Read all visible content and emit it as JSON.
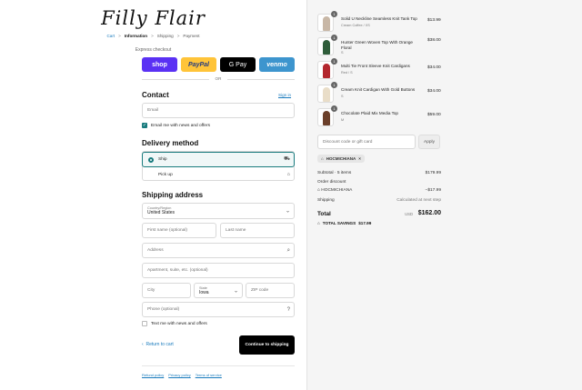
{
  "brand": {
    "logo_text": "Filly Flair"
  },
  "breadcrumb": {
    "items": [
      "Cart",
      "Information",
      "Shipping",
      "Payment"
    ],
    "separator": ">"
  },
  "express": {
    "label": "Express checkout",
    "buttons": [
      "shop",
      "PayPal",
      "G Pay",
      "venmo"
    ],
    "or": "OR"
  },
  "contact": {
    "title": "Contact",
    "sign_in": "Sign in",
    "email_placeholder": "Email",
    "email_news": "Email me with news and offers"
  },
  "delivery": {
    "title": "Delivery method",
    "options": [
      "Ship",
      "Pick up"
    ]
  },
  "shipping": {
    "title": "Shipping address",
    "country_label": "Country/Region",
    "country_value": "United States",
    "first_name": "First name (optional)",
    "last_name": "Last name",
    "address": "Address",
    "apartment": "Apartment, suite, etc. (optional)",
    "city": "City",
    "state_label": "State",
    "state_value": "Iowa",
    "zip": "ZIP code",
    "phone": "Phone (optional)",
    "text_news": "Text me with news and offers"
  },
  "actions": {
    "back": "Return to cart",
    "continue": "Continue to shipping"
  },
  "policies": [
    "Refund policy",
    "Privacy policy",
    "Terms of service"
  ],
  "cart": {
    "items": [
      {
        "qty": "1",
        "name": "Solid U Neckline Seamless Knit Tank Top",
        "variant": "Cream Coffee / XS",
        "price": "$13.99"
      },
      {
        "qty": "1",
        "name": "Hunter Green Woven Top With Orange Floral",
        "variant": "S",
        "price": "$38.00"
      },
      {
        "qty": "1",
        "name": "Multi Tie Front Sleeve Knit Cardigans",
        "variant": "Red / S",
        "price": "$34.00"
      },
      {
        "qty": "1",
        "name": "Cream Knit Cardigan With Gold Buttons",
        "variant": "S",
        "price": "$34.00"
      },
      {
        "qty": "1",
        "name": "Chocolate Plaid Mix Media Top",
        "variant": "M",
        "price": "$59.00"
      }
    ],
    "discount_placeholder": "Discount code or gift card",
    "apply": "Apply",
    "applied_code": "HOCMICHIANA",
    "subtotal_label": "Subtotal · 5 items",
    "subtotal": "$179.99",
    "order_discount_label": "Order discount",
    "discount_code": "HOCMICHIANA",
    "discount_value": "−$17.99",
    "shipping_label": "Shipping",
    "shipping_value": "Calculated at next step",
    "total_label": "Total",
    "currency": "USD",
    "total": "$162.00",
    "savings_label": "TOTAL SAVINGS",
    "savings_value": "$17.99"
  },
  "colors": {
    "accent": "#197b7e",
    "link": "#197bbd",
    "shop_pay": "#5a31f4",
    "paypal": "#ffc439",
    "gpay": "#000000",
    "venmo": "#3d95ce",
    "item_colors": [
      "#c8b7a6",
      "#2f5d3a",
      "#b3262d",
      "#e9ddc8",
      "#6b3f2a"
    ]
  }
}
